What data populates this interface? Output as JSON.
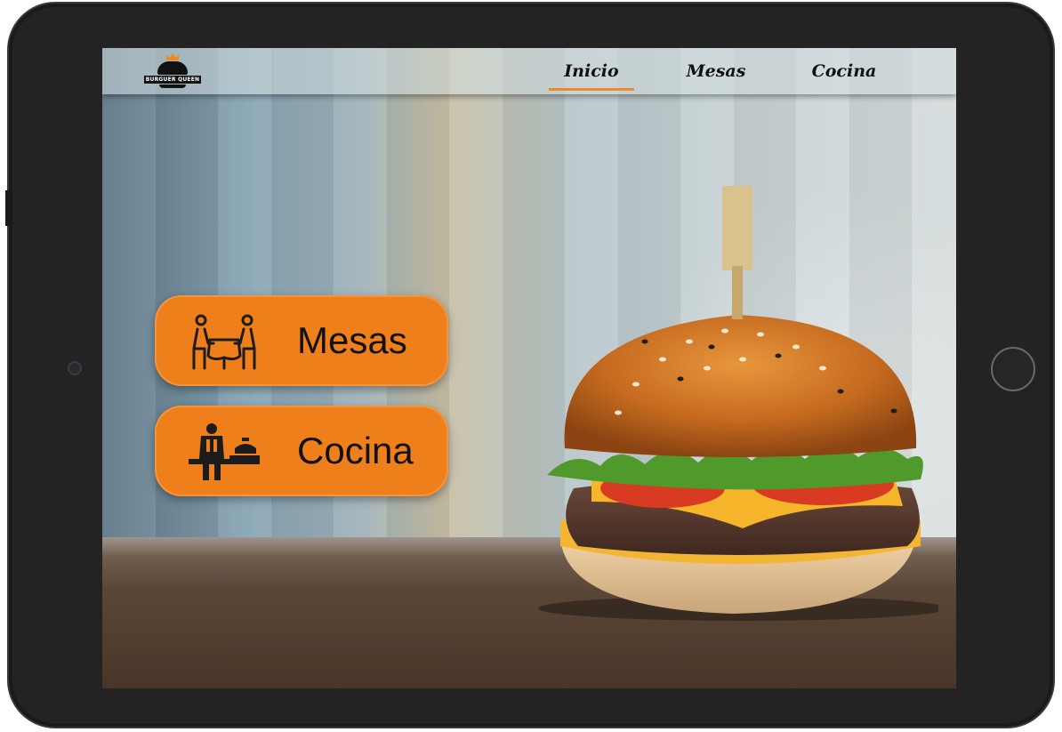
{
  "brand": {
    "logo_text": "BURGUER QUEEN"
  },
  "nav": {
    "items": [
      {
        "label": "Inicio",
        "active": true
      },
      {
        "label": "Mesas",
        "active": false
      },
      {
        "label": "Cocina",
        "active": false
      }
    ]
  },
  "actions": {
    "mesas_label": "Mesas",
    "cocina_label": "Cocina"
  },
  "colors": {
    "accent": "#ef7f1a",
    "frame": "#232323"
  },
  "icons": {
    "mesas": "dining-table-icon",
    "cocina": "chef-cooking-icon",
    "logo": "crown-burger-logo"
  }
}
